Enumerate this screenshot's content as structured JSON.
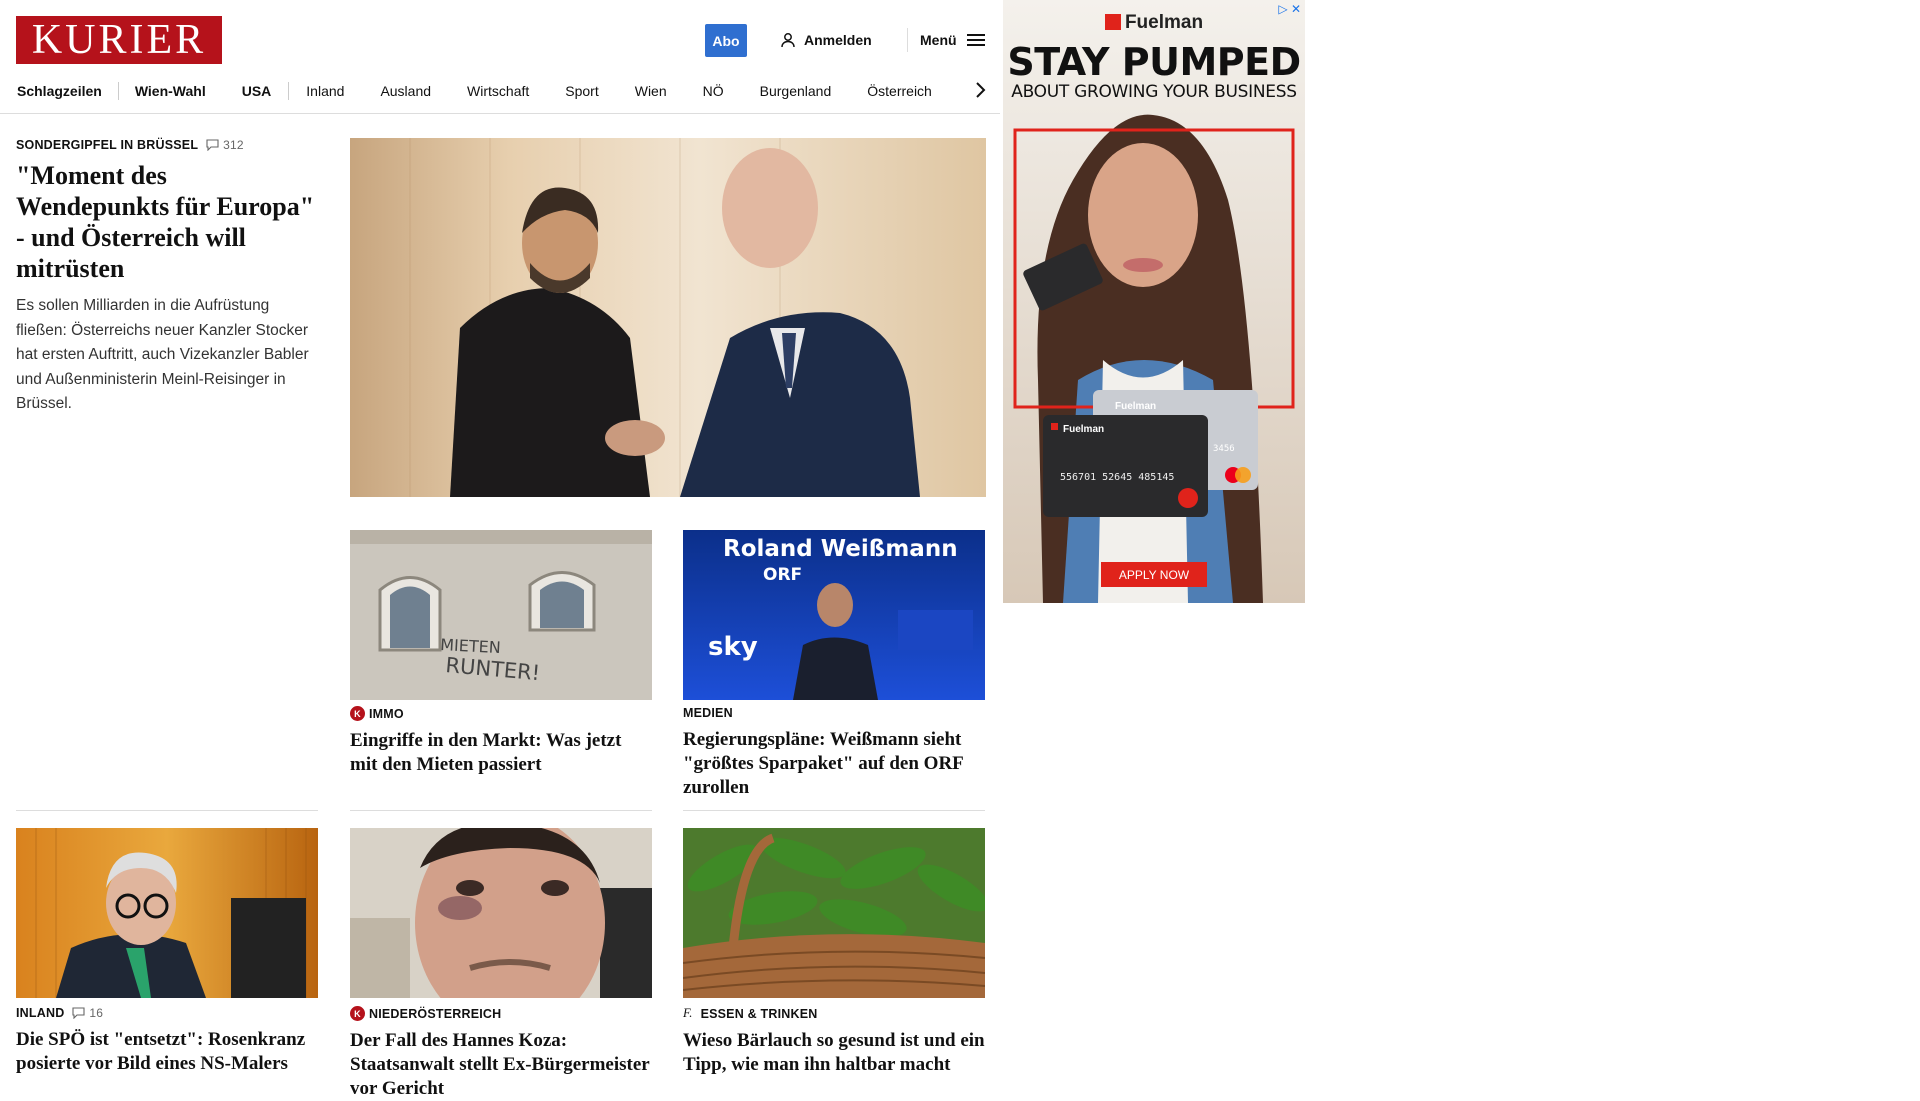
{
  "header": {
    "logo": "KURIER",
    "abo": "Abo",
    "login": "Anmelden",
    "menu": "Menü"
  },
  "nav": {
    "items": [
      "Schlagzeilen",
      "Wien-Wahl",
      "USA",
      "Inland",
      "Ausland",
      "Wirtschaft",
      "Sport",
      "Wien",
      "NÖ",
      "Burgenland",
      "Österreich"
    ]
  },
  "lead": {
    "kicker": "SONDERGIPFEL IN BRÜSSEL",
    "comments": "312",
    "title": "\"Moment des Wendepunkts für Europa\" - und Österreich will mitrüsten",
    "desc": "Es sollen Milliarden in die Aufrüstung fließen: Österreichs neuer Kanzler Stocker hat ersten Auftritt, auch Vizekanzler Babler und Außenministerin Meinl-Reisinger in Brüssel."
  },
  "cards": [
    {
      "kicker": "IMMO",
      "badge": "K",
      "title": "Eingriffe in den Markt: Was jetzt mit den Mieten passiert",
      "graffiti1": "MIETEN",
      "graffiti2": "RUNTER!"
    },
    {
      "kicker": "MEDIEN",
      "title": "Regierungspläne: Weißmann sieht \"größtes Sparpaket\" auf den ORF zurollen",
      "banner": "Roland Weißmann",
      "banner2": "ORF",
      "sky": "sky"
    },
    {
      "kicker": "INLAND",
      "comments": "16",
      "title": "Die SPÖ ist \"entsetzt\": Rosenkranz posierte vor Bild eines NS-Malers"
    },
    {
      "kicker": "NIEDERÖSTERREICH",
      "badge": "K",
      "title": "Der Fall des Hannes Koza: Staatsanwalt stellt Ex-Bürgermeister vor Gericht"
    },
    {
      "kicker": "ESSEN & TRINKEN",
      "badge": "f.",
      "title": "Wieso Bärlauch so gesund ist und ein Tipp, wie man ihn haltbar macht"
    }
  ],
  "ad": {
    "brand": "Fuelman",
    "headline": "STAY PUMPED",
    "subline": "ABOUT GROWING YOUR BUSINESS",
    "cta": "APPLY NOW",
    "card_number": "556701 52645 485145",
    "card_brand": "Fuelman",
    "card_back_brand": "Fuelman",
    "card_last": "3456"
  },
  "colors": {
    "brand_red": "#b5121b",
    "abo_blue": "#2f6fd0"
  }
}
